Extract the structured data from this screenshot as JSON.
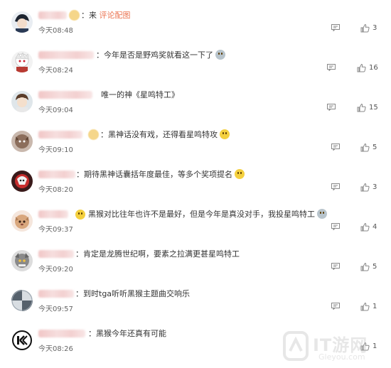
{
  "comments": [
    {
      "prefix": "：来 ",
      "text": "评论配图",
      "text_accent": true,
      "time": "今天08:48",
      "likes": "3"
    },
    {
      "prefix": "：",
      "text": "今年是否是野鸡奖就看这一下了",
      "text_accent": false,
      "time": "今天08:24",
      "likes": "16"
    },
    {
      "prefix": "",
      "text": "唯一的神《星鸣特工》",
      "text_accent": false,
      "time": "今天09:04",
      "likes": "15"
    },
    {
      "prefix": "：",
      "text": "黑神话没有戏，还得看星鸣特攻",
      "text_accent": false,
      "time": "今天09:10",
      "likes": "5"
    },
    {
      "prefix": "：",
      "text": "期待黑神话囊括年度最佳，等多个奖项提名",
      "text_accent": false,
      "time": "今天08:20",
      "likes": "3"
    },
    {
      "prefix": "",
      "text": "黑猴对比往年也许不是最好，但是今年是真没对手，我投星鸣特工",
      "text_accent": false,
      "time": "今天09:37",
      "likes": "4"
    },
    {
      "prefix": "：",
      "text": "肯定是龙腾世纪啊，要素之拉满更甚星鸣特工",
      "text_accent": false,
      "time": "今天09:20",
      "likes": "5"
    },
    {
      "prefix": "：",
      "text": "到时tga听听黑猴主题曲交响乐",
      "text_accent": false,
      "time": "今天09:57",
      "likes": "1"
    },
    {
      "prefix": "：",
      "text": "黑猴今年还真有可能",
      "text_accent": false,
      "time": "今天08:26",
      "likes": "1"
    }
  ],
  "watermark": {
    "name": "IT游网",
    "url": "Gleyou.com"
  },
  "colors": {
    "accent": "#eb7350",
    "icon": "#888888"
  }
}
